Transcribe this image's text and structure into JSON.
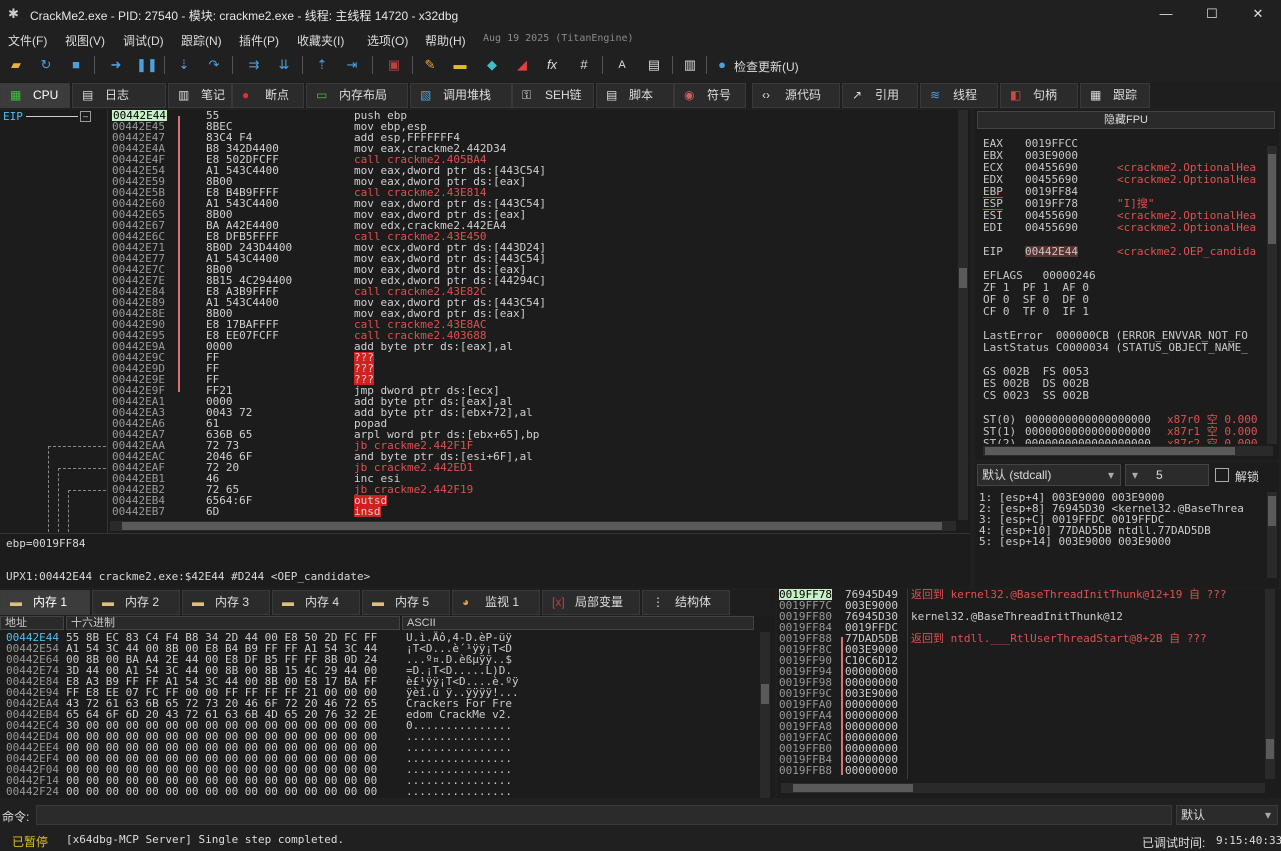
{
  "window": {
    "title": "CrackMe2.exe - PID: 27540 - 模块: crackme2.exe - 线程: 主线程 14720 - x32dbg",
    "controls": [
      "—",
      "☐",
      "✕"
    ]
  },
  "menu": {
    "items": [
      "文件(F)",
      "视图(V)",
      "调试(D)",
      "跟踪(N)",
      "插件(P)",
      "收藏夹(I)",
      "选项(O)",
      "帮助(H)"
    ],
    "date": "Aug 19 2025 (TitanEngine)"
  },
  "toolbar": {
    "update_label": "检查更新(U)"
  },
  "main_tabs": [
    {
      "label": "CPU",
      "icon": "cpu-icon"
    },
    {
      "label": "日志",
      "icon": "log-icon"
    },
    {
      "label": "笔记",
      "icon": "notes-icon"
    },
    {
      "label": "断点",
      "icon": "breakpoint-icon"
    },
    {
      "label": "内存布局",
      "icon": "memory-map-icon"
    },
    {
      "label": "调用堆栈",
      "icon": "call-stack-icon"
    },
    {
      "label": "SEH链",
      "icon": "seh-icon"
    },
    {
      "label": "脚本",
      "icon": "script-icon"
    },
    {
      "label": "符号",
      "icon": "symbol-icon"
    },
    {
      "label": "源代码",
      "icon": "source-icon"
    },
    {
      "label": "引用",
      "icon": "reference-icon"
    },
    {
      "label": "线程",
      "icon": "thread-icon"
    },
    {
      "label": "句柄",
      "icon": "handle-icon"
    },
    {
      "label": "跟踪",
      "icon": "trace-icon"
    }
  ],
  "disasm": {
    "eip_label": "EIP",
    "rows": [
      {
        "addr": "00442E44",
        "bytes": "55",
        "instr": "push ebp"
      },
      {
        "addr": "00442E45",
        "bytes": "8BEC",
        "instr": "mov ebp,esp"
      },
      {
        "addr": "00442E47",
        "bytes": "83C4 F4",
        "instr": "add esp,FFFFFFF4"
      },
      {
        "addr": "00442E4A",
        "bytes": "B8 342D4400",
        "instr": "mov eax,crackme2.442D34"
      },
      {
        "addr": "00442E4F",
        "bytes": "E8 502DFCFF",
        "instr": "call crackme2.405BA4"
      },
      {
        "addr": "00442E54",
        "bytes": "A1 543C4400",
        "instr": "mov eax,dword ptr ds:[443C54]"
      },
      {
        "addr": "00442E59",
        "bytes": "8B00",
        "instr": "mov eax,dword ptr ds:[eax]"
      },
      {
        "addr": "00442E5B",
        "bytes": "E8 B4B9FFFF",
        "instr": "call crackme2.43E814"
      },
      {
        "addr": "00442E60",
        "bytes": "A1 543C4400",
        "instr": "mov eax,dword ptr ds:[443C54]"
      },
      {
        "addr": "00442E65",
        "bytes": "8B00",
        "instr": "mov eax,dword ptr ds:[eax]"
      },
      {
        "addr": "00442E67",
        "bytes": "BA A42E4400",
        "instr": "mov edx,crackme2.442EA4"
      },
      {
        "addr": "00442E6C",
        "bytes": "E8 DFB5FFFF",
        "instr": "call crackme2.43E450"
      },
      {
        "addr": "00442E71",
        "bytes": "8B0D 243D4400",
        "instr": "mov ecx,dword ptr ds:[443D24]"
      },
      {
        "addr": "00442E77",
        "bytes": "A1 543C4400",
        "instr": "mov eax,dword ptr ds:[443C54]"
      },
      {
        "addr": "00442E7C",
        "bytes": "8B00",
        "instr": "mov eax,dword ptr ds:[eax]"
      },
      {
        "addr": "00442E7E",
        "bytes": "8B15 4C294400",
        "instr": "mov edx,dword ptr ds:[44294C]"
      },
      {
        "addr": "00442E84",
        "bytes": "E8 A3B9FFFF",
        "instr": "call crackme2.43E82C"
      },
      {
        "addr": "00442E89",
        "bytes": "A1 543C4400",
        "instr": "mov eax,dword ptr ds:[443C54]"
      },
      {
        "addr": "00442E8E",
        "bytes": "8B00",
        "instr": "mov eax,dword ptr ds:[eax]"
      },
      {
        "addr": "00442E90",
        "bytes": "E8 17BAFFFF",
        "instr": "call crackme2.43E8AC"
      },
      {
        "addr": "00442E95",
        "bytes": "E8 EE07FCFF",
        "instr": "call crackme2.403688"
      },
      {
        "addr": "00442E9A",
        "bytes": "0000",
        "instr": "add byte ptr ds:[eax],al"
      },
      {
        "addr": "00442E9C",
        "bytes": "FF",
        "instr": "???"
      },
      {
        "addr": "00442E9D",
        "bytes": "FF",
        "instr": "???"
      },
      {
        "addr": "00442E9E",
        "bytes": "FF",
        "instr": "???"
      },
      {
        "addr": "00442E9F",
        "bytes": "FF21",
        "instr": "jmp dword ptr ds:[ecx]"
      },
      {
        "addr": "00442EA1",
        "bytes": "0000",
        "instr": "add byte ptr ds:[eax],al"
      },
      {
        "addr": "00442EA3",
        "bytes": "0043 72",
        "instr": "add byte ptr ds:[ebx+72],al"
      },
      {
        "addr": "00442EA6",
        "bytes": "61",
        "instr": "popad"
      },
      {
        "addr": "00442EA7",
        "bytes": "636B 65",
        "instr": "arpl word ptr ds:[ebx+65],bp"
      },
      {
        "addr": "00442EAA",
        "bytes": "72 73",
        "instr": "jb crackme2.442F1F"
      },
      {
        "addr": "00442EAC",
        "bytes": "2046 6F",
        "instr": "and byte ptr ds:[esi+6F],al"
      },
      {
        "addr": "00442EAF",
        "bytes": "72 20",
        "instr": "jb crackme2.442ED1"
      },
      {
        "addr": "00442EB1",
        "bytes": "46",
        "instr": "inc esi"
      },
      {
        "addr": "00442EB2",
        "bytes": "72 65",
        "instr": "jb crackme2.442F19"
      },
      {
        "addr": "00442EB4",
        "bytes": "6564:6F",
        "instr": "outsd"
      },
      {
        "addr": "00442EB7",
        "bytes": "6D",
        "instr": "insd"
      }
    ],
    "info_line1": "ebp=0019FF84",
    "info_line2": "UPX1:00442E44 crackme2.exe:$42E44 #D244 <OEP_candidate>"
  },
  "registers": {
    "hide_fpu": "隐藏FPU",
    "general": [
      {
        "name": "EAX",
        "value": "0019FFCC",
        "comment": ""
      },
      {
        "name": "EBX",
        "value": "003E9000",
        "comment": ""
      },
      {
        "name": "ECX",
        "value": "00455690",
        "comment": "<crackme2.OptionalHea"
      },
      {
        "name": "EDX",
        "value": "00455690",
        "comment": "<crackme2.OptionalHea"
      },
      {
        "name": "EBP",
        "value": "0019FF84",
        "comment": ""
      },
      {
        "name": "ESP",
        "value": "0019FF78",
        "comment": "\"I]搜\""
      },
      {
        "name": "ESI",
        "value": "00455690",
        "comment": "<crackme2.OptionalHea"
      },
      {
        "name": "EDI",
        "value": "00455690",
        "comment": "<crackme2.OptionalHea"
      }
    ],
    "eip": {
      "name": "EIP",
      "value": "00442E44",
      "comment": "<crackme2.OEP_candida"
    },
    "eflags": "EFLAGS   00000246",
    "flags": [
      "ZF 1  PF 1  AF 0",
      "OF 0  SF 0  DF 0",
      "CF 0  TF 0  IF 1"
    ],
    "last_error": "LastError  000000CB (ERROR_ENVVAR_NOT_FO",
    "last_status": "LastStatus C0000034 (STATUS_OBJECT_NAME_",
    "segs": [
      "GS 002B  FS 0053",
      "ES 002B  DS 002B",
      "CS 0023  SS 002B"
    ],
    "fpu": [
      {
        "name": "ST(0)",
        "value": "0000000000000000000",
        "tail": "x87r0 空 0.000"
      },
      {
        "name": "ST(1)",
        "value": "0000000000000000000",
        "tail": "x87r1 空 0.000"
      },
      {
        "name": "ST(2)",
        "value": "0000000000000000000",
        "tail": "x87r2 空 0.000"
      }
    ]
  },
  "call_conv": {
    "selected": "默认 (stdcall)",
    "count": "5",
    "unlock": "解锁",
    "args": [
      "1: [esp+4] 003E9000 003E9000",
      "2: [esp+8] 76945D30 <kernel32.@BaseThrea",
      "3: [esp+C] 0019FFDC 0019FFDC",
      "4: [esp+10] 77DAD5DB ntdll.77DAD5DB",
      "5: [esp+14] 003E9000 003E9000"
    ]
  },
  "dump_tabs": [
    {
      "label": "内存 1",
      "icon": "dump-icon"
    },
    {
      "label": "内存 2",
      "icon": "dump-icon"
    },
    {
      "label": "内存 3",
      "icon": "dump-icon"
    },
    {
      "label": "内存 4",
      "icon": "dump-icon"
    },
    {
      "label": "内存 5",
      "icon": "dump-icon"
    },
    {
      "label": "监视 1",
      "icon": "watch-icon"
    },
    {
      "label": "局部变量",
      "icon": "locals-icon"
    },
    {
      "label": "结构体",
      "icon": "struct-icon"
    }
  ],
  "dump": {
    "headers": [
      "地址",
      "十六进制",
      "ASCII"
    ],
    "rows": [
      {
        "addr": "00442E44",
        "hex": "55 8B EC 83 C4 F4 B8 34 2D 44 00 E8 50 2D FC FF",
        "ascii": "U.ì.Äô,4-D.èP-üÿ"
      },
      {
        "addr": "00442E54",
        "hex": "A1 54 3C 44 00 8B 00 E8 B4 B9 FF FF A1 54 3C 44",
        "ascii": "¡T<D...è´¹ÿÿ¡T<D"
      },
      {
        "addr": "00442E64",
        "hex": "00 8B 00 BA A4 2E 44 00 E8 DF B5 FF FF 8B 0D 24",
        "ascii": "...º¤.D.èßµÿÿ..$"
      },
      {
        "addr": "00442E74",
        "hex": "3D 44 00 A1 54 3C 44 00 8B 00 8B 15 4C 29 44 00",
        "ascii": "=D.¡T<D.....L)D."
      },
      {
        "addr": "00442E84",
        "hex": "E8 A3 B9 FF FF A1 54 3C 44 00 8B 00 E8 17 BA FF",
        "ascii": "è£¹ÿÿ¡T<D....è.ºÿ"
      },
      {
        "addr": "00442E94",
        "hex": "FF E8 EE 07 FC FF 00 00 FF FF FF FF 21 00 00 00",
        "ascii": "ÿèî.ü ÿ..ÿÿÿÿ!..."
      },
      {
        "addr": "00442EA4",
        "hex": "43 72 61 63 6B 65 72 73 20 46 6F 72 20 46 72 65",
        "ascii": "Crackers For Fre"
      },
      {
        "addr": "00442EB4",
        "hex": "65 64 6F 6D 20 43 72 61 63 6B 4D 65 20 76 32 2E",
        "ascii": "edom CrackMe v2."
      },
      {
        "addr": "00442EC4",
        "hex": "30 00 00 00 00 00 00 00 00 00 00 00 00 00 00 00",
        "ascii": "0..............."
      },
      {
        "addr": "00442ED4",
        "hex": "00 00 00 00 00 00 00 00 00 00 00 00 00 00 00 00",
        "ascii": "................"
      },
      {
        "addr": "00442EE4",
        "hex": "00 00 00 00 00 00 00 00 00 00 00 00 00 00 00 00",
        "ascii": "................"
      },
      {
        "addr": "00442EF4",
        "hex": "00 00 00 00 00 00 00 00 00 00 00 00 00 00 00 00",
        "ascii": "................"
      },
      {
        "addr": "00442F04",
        "hex": "00 00 00 00 00 00 00 00 00 00 00 00 00 00 00 00",
        "ascii": "................"
      },
      {
        "addr": "00442F14",
        "hex": "00 00 00 00 00 00 00 00 00 00 00 00 00 00 00 00",
        "ascii": "................"
      },
      {
        "addr": "00442F24",
        "hex": "00 00 00 00 00 00 00 00 00 00 00 00 00 00 00 00",
        "ascii": "................"
      }
    ]
  },
  "stack": {
    "rows": [
      {
        "addr": "0019FF78",
        "val": "76945D49",
        "comment": "返回到 kernel32.@BaseThreadInitThunk@12+19 自 ???"
      },
      {
        "addr": "0019FF7C",
        "val": "003E9000",
        "comment": ""
      },
      {
        "addr": "0019FF80",
        "val": "76945D30",
        "comment": "kernel32.@BaseThreadInitThunk@12"
      },
      {
        "addr": "0019FF84",
        "val": "0019FFDC",
        "comment": ""
      },
      {
        "addr": "0019FF88",
        "val": "77DAD5DB",
        "comment": "返回到 ntdll.___RtlUserThreadStart@8+2B 自 ???"
      },
      {
        "addr": "0019FF8C",
        "val": "003E9000",
        "comment": ""
      },
      {
        "addr": "0019FF90",
        "val": "C10C6D12",
        "comment": ""
      },
      {
        "addr": "0019FF94",
        "val": "00000000",
        "comment": ""
      },
      {
        "addr": "0019FF98",
        "val": "00000000",
        "comment": ""
      },
      {
        "addr": "0019FF9C",
        "val": "003E9000",
        "comment": ""
      },
      {
        "addr": "0019FFA0",
        "val": "00000000",
        "comment": ""
      },
      {
        "addr": "0019FFA4",
        "val": "00000000",
        "comment": ""
      },
      {
        "addr": "0019FFA8",
        "val": "00000000",
        "comment": ""
      },
      {
        "addr": "0019FFAC",
        "val": "00000000",
        "comment": ""
      },
      {
        "addr": "0019FFB0",
        "val": "00000000",
        "comment": ""
      },
      {
        "addr": "0019FFB4",
        "val": "00000000",
        "comment": ""
      },
      {
        "addr": "0019FFB8",
        "val": "00000000",
        "comment": ""
      }
    ]
  },
  "command": {
    "label": "命令:",
    "value": "",
    "mode": "默认"
  },
  "status": {
    "state": "已暂停",
    "message": "[x64dbg-MCP Server] Single step completed.",
    "time_label": "已调试时间:",
    "time": "9:15:40:33"
  }
}
